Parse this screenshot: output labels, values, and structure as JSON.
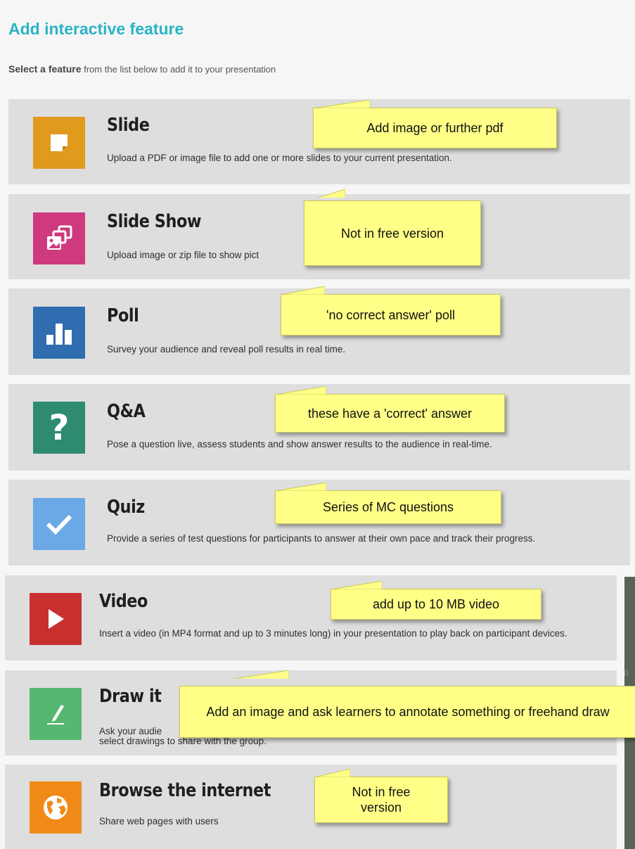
{
  "dialog": {
    "title": "Add interactive feature",
    "subtitle_bold": "Select a feature",
    "subtitle_rest": " from the list below to add it to your presentation"
  },
  "features": [
    {
      "name": "Slide",
      "description": "Upload a PDF or image file to add one or more slides to your current presentation.",
      "icon": "slide-icon",
      "color": "#e09a1d"
    },
    {
      "name": "Slide Show",
      "description": "Upload image or zip file to show pict",
      "icon": "slideshow-icon",
      "color": "#cf3a7e"
    },
    {
      "name": "Poll",
      "description": "Survey your audience and reveal poll results in real time.",
      "icon": "poll-chart-icon",
      "color": "#2f6db0"
    },
    {
      "name": "Q&A",
      "description": "Pose a question live, assess students and show answer results to the audience in real-time.",
      "icon": "question-mark-icon",
      "color": "#2e8b6f"
    },
    {
      "name": "Quiz",
      "description": "Provide a series of test questions for participants to answer at their own pace and track their progress.",
      "icon": "checkmark-icon",
      "color": "#6aa8e6"
    },
    {
      "name": "Video",
      "description": "Insert a video (in MP4 format and up to 3 minutes long) in your presentation to play back on participant devices.",
      "icon": "play-icon",
      "color": "#c8302f"
    },
    {
      "name": "Draw it",
      "description_line1": "Ask your audie",
      "description_line2": "select drawings to share with the group.",
      "icon": "pencil-icon",
      "color": "#56b870"
    },
    {
      "name": "Browse the internet",
      "description": "Share web pages with users",
      "icon": "globe-icon",
      "color": "#f08a16"
    }
  ],
  "notes": [
    {
      "text": "Add image or further pdf"
    },
    {
      "text": "Not in free version"
    },
    {
      "text": "'no correct answer' poll"
    },
    {
      "text": "these have a 'correct' answer"
    },
    {
      "text": "Series of MC questions"
    },
    {
      "text": "add up to 10 MB video"
    },
    {
      "text": "Add an image and ask learners to annotate something or freehand draw"
    },
    {
      "text": "Not in free version"
    }
  ],
  "background_fragment": "ti"
}
